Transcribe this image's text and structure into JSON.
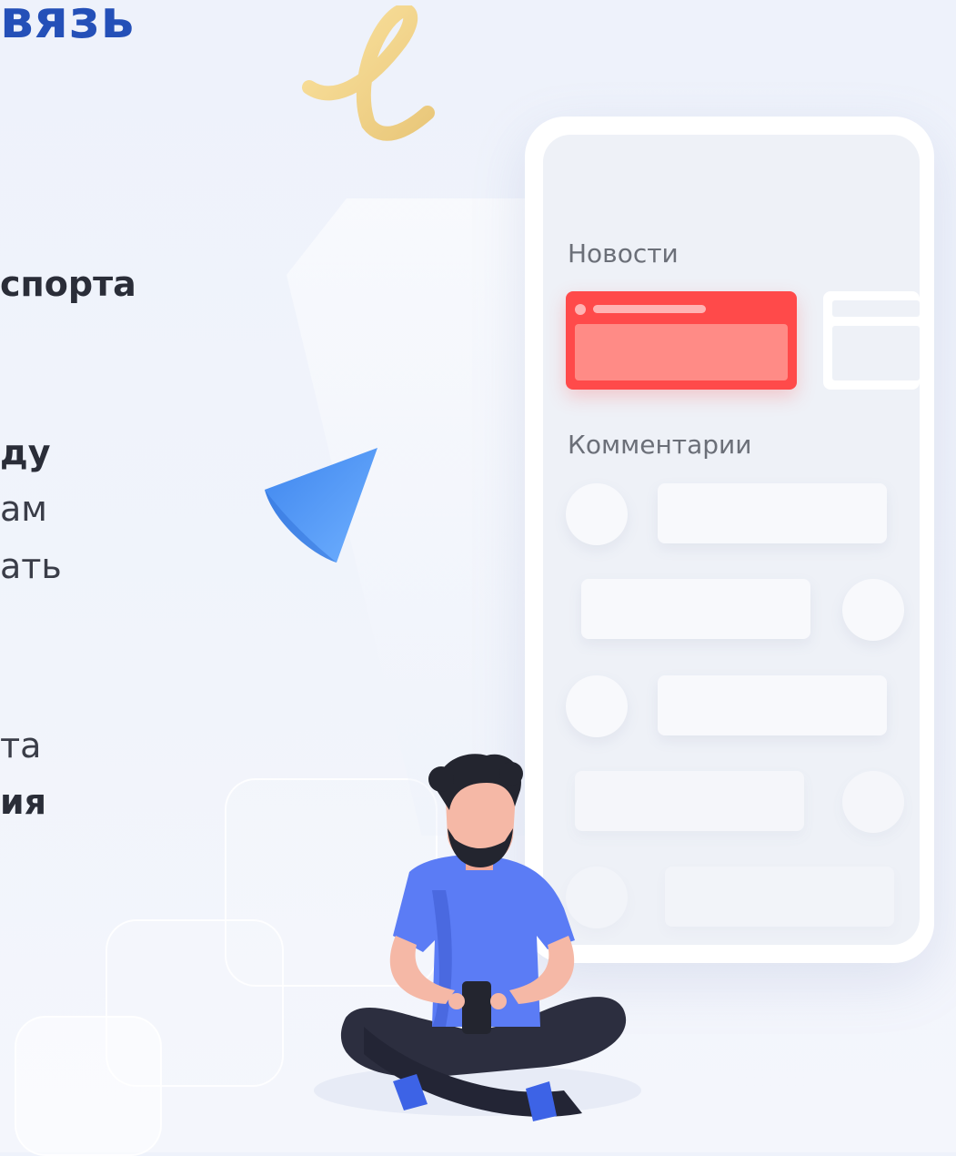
{
  "left_text": {
    "heading": "вязь",
    "line1": "спорта",
    "line2": "ду",
    "line3": "ам",
    "line4": "ать",
    "line5": "та",
    "line6": "ия"
  },
  "phone": {
    "news_label": "Новости",
    "comments_label": "Комментарии"
  },
  "colors": {
    "heading": "#2450b8",
    "news_card": "#ff4a4a",
    "shirt": "#5b7cf5"
  },
  "icons": {
    "swirl": "swirl-decoration-icon",
    "cone": "cone-decoration-icon",
    "person": "person-with-phone-illustration"
  }
}
